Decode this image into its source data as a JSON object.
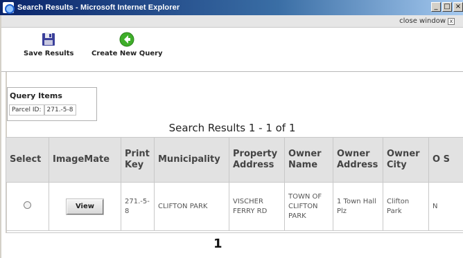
{
  "window": {
    "title": "Search Results - Microsoft Internet Explorer",
    "min_label": "_",
    "max_label": "□",
    "close_label": "×"
  },
  "close_strip": {
    "label": "close window",
    "icon_label": "x"
  },
  "toolbar": {
    "save_label": "Save Results",
    "create_label": "Create New Query"
  },
  "query_items": {
    "title": "Query Items",
    "label": "Parcel ID:",
    "value": "271.-5-8"
  },
  "results": {
    "heading": "Search Results 1 - 1 of 1",
    "columns": [
      "Select",
      "ImageMate",
      "Print Key",
      "Municipality",
      "Property Address",
      "Owner Name",
      "Owner Address",
      "Owner City",
      "O S"
    ],
    "row": {
      "view_label": "View",
      "print_key": "271.-5-8",
      "municipality": "CLIFTON PARK",
      "property_address": "VISCHER FERRY RD",
      "owner_name": "TOWN OF CLIFTON PARK",
      "owner_address": "1 Town Hall Plz",
      "owner_city": "Clifton Park",
      "owner_state": "N"
    },
    "page": "1"
  },
  "colors": {
    "titlebar_start": "#0a246a",
    "titlebar_end": "#a6caf0",
    "header_bg": "#e2e2e2",
    "save_icon": "#3a3f9a",
    "new_icon": "#3fae2a"
  }
}
